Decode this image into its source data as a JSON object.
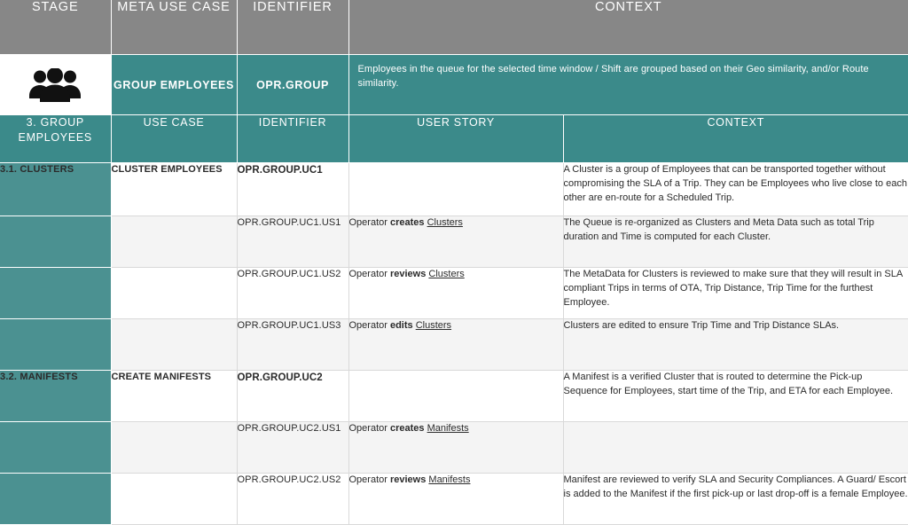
{
  "header": {
    "columns": [
      "STAGE",
      "META USE CASE",
      "IDENTIFIER",
      "CONTEXT"
    ]
  },
  "meta_row": {
    "icon": "group-employees-icon",
    "meta_use_case": "GROUP EMPLOYEES",
    "identifier": "OPR.GROUP",
    "context": "Employees in the queue for the selected time window / Shift are grouped based on their Geo similarity, and/or Route similarity."
  },
  "subheader": {
    "stage": "3. GROUP EMPLOYEES",
    "columns": [
      "USE CASE",
      "IDENTIFIER",
      "USER STORY",
      "CONTEXT"
    ]
  },
  "rows": [
    {
      "stage": "3.1. CLUSTERS",
      "use_case": "CLUSTER EMPLOYEES",
      "identifier": "OPR.GROUP.UC1",
      "identifier_bold": true,
      "story_prefix": "",
      "story_verb": "",
      "story_suffix": "",
      "context": "A Cluster is a group of Employees that can be transported together without compromising the SLA of a Trip. They can be Employees who live close to each other are en-route for a Scheduled Trip.",
      "shade": "white"
    },
    {
      "stage": "",
      "use_case": "",
      "identifier": "OPR.GROUP.UC1.US1",
      "identifier_bold": false,
      "story_prefix": "Operator ",
      "story_verb": "creates",
      "story_suffix": "Clusters",
      "context": "The Queue is re-organized as Clusters and Meta Data such as total Trip duration and Time is computed for each Cluster.",
      "shade": "grey"
    },
    {
      "stage": "",
      "use_case": "",
      "identifier": "OPR.GROUP.UC1.US2",
      "identifier_bold": false,
      "story_prefix": "Operator ",
      "story_verb": "reviews",
      "story_suffix": "Clusters",
      "context": "The MetaData for Clusters is reviewed to make sure that they will result in SLA compliant Trips in terms of OTA, Trip Distance, Trip Time for the furthest Employee.",
      "shade": "white"
    },
    {
      "stage": "",
      "use_case": "",
      "identifier": "OPR.GROUP.UC1.US3",
      "identifier_bold": false,
      "story_prefix": "Operator ",
      "story_verb": "edits",
      "story_suffix": "Clusters",
      "context": "Clusters are edited to ensure Trip Time and Trip Distance SLAs.",
      "shade": "grey"
    },
    {
      "stage": "3.2. MANIFESTS",
      "use_case": "CREATE MANIFESTS",
      "identifier": "OPR.GROUP.UC2",
      "identifier_bold": true,
      "story_prefix": "",
      "story_verb": "",
      "story_suffix": "",
      "context": "A Manifest is a verified Cluster that is routed to determine the Pick-up Sequence for Employees, start time of the Trip, and ETA for each Employee.",
      "shade": "white"
    },
    {
      "stage": "",
      "use_case": "",
      "identifier": "OPR.GROUP.UC2.US1",
      "identifier_bold": false,
      "story_prefix": "Operator ",
      "story_verb": "creates",
      "story_suffix": "Manifests",
      "context": "",
      "shade": "grey"
    },
    {
      "stage": "",
      "use_case": "",
      "identifier": "OPR.GROUP.UC2.US2",
      "identifier_bold": false,
      "story_prefix": "Operator ",
      "story_verb": "reviews",
      "story_suffix": "Manifests",
      "context": "Manifest are reviewed to verify SLA and Security Compliances. A Guard/ Escort is added to the Manifest if the first pick-up or last drop-off is a female Employee.",
      "shade": "white"
    }
  ],
  "colors": {
    "header_grey": "#878787",
    "teal_dark": "#3b8a8a",
    "teal_stage": "#4b9191",
    "row_grey": "#f4f4f4",
    "border": "#d9d9d9"
  }
}
